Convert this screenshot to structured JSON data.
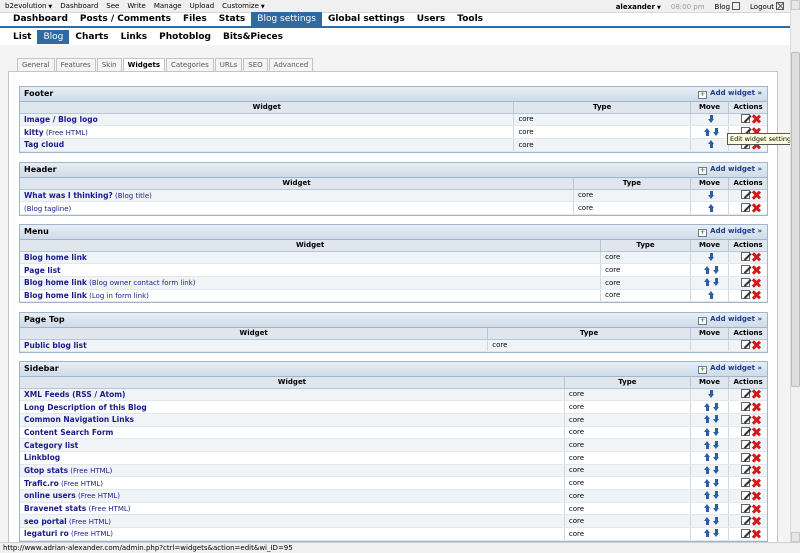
{
  "topbar": {
    "site": "b2evolution",
    "items": [
      "Dashboard",
      "See",
      "Write",
      "Manage",
      "Upload",
      "Customize"
    ],
    "user": "alexander",
    "time": "08:00 pm",
    "blog_label": "Blog",
    "logout_label": "Logout"
  },
  "main_tabs": [
    "Dashboard",
    "Posts / Comments",
    "Files",
    "Stats",
    "Blog settings",
    "Global settings",
    "Users",
    "Tools"
  ],
  "main_tab_active": "Blog settings",
  "sub_tabs": [
    "List",
    "Blog",
    "Charts",
    "Links",
    "Photoblog",
    "Bits&Pieces"
  ],
  "sub_tab_active": "Blog",
  "settings_tabs": [
    "General",
    "Features",
    "Skin",
    "Widgets",
    "Categories",
    "URLs",
    "SEO",
    "Advanced"
  ],
  "settings_tab_active": "Widgets",
  "add_widget_label": "Add widget »",
  "columns": {
    "widget": "Widget",
    "type": "Type",
    "move": "Move",
    "actions": "Actions"
  },
  "containers": [
    {
      "name": "Footer",
      "rows": [
        {
          "name": "Image / Blog logo",
          "sub": "",
          "type": "core",
          "move": [
            "down"
          ]
        },
        {
          "name": "kitty",
          "sub": "(Free HTML)",
          "type": "core",
          "move": [
            "up",
            "down"
          ]
        },
        {
          "name": "Tag cloud",
          "sub": "",
          "type": "core",
          "move": [
            "up"
          ]
        }
      ]
    },
    {
      "name": "Header",
      "rows": [
        {
          "name": "What was I thinking?",
          "sub": "(Blog title)",
          "type": "core",
          "move": [
            "down"
          ]
        },
        {
          "name": "",
          "sub": "(Blog tagline)",
          "type": "core",
          "move": [
            "up"
          ]
        }
      ]
    },
    {
      "name": "Menu",
      "rows": [
        {
          "name": "Blog home link",
          "sub": "",
          "type": "core",
          "move": [
            "down"
          ]
        },
        {
          "name": "Page list",
          "sub": "",
          "type": "core",
          "move": [
            "up",
            "down"
          ]
        },
        {
          "name": "Blog home link",
          "sub": "(Blog owner contact form link)",
          "type": "core",
          "move": [
            "up",
            "down"
          ]
        },
        {
          "name": "Blog home link",
          "sub": "(Log in form link)",
          "type": "core",
          "move": [
            "up"
          ]
        }
      ]
    },
    {
      "name": "Page Top",
      "rows": [
        {
          "name": "Public blog list",
          "sub": "",
          "type": "core",
          "move": []
        }
      ]
    },
    {
      "name": "Sidebar",
      "rows": [
        {
          "name": "XML Feeds (RSS / Atom)",
          "sub": "",
          "type": "core",
          "move": [
            "down"
          ]
        },
        {
          "name": "Long Description of this Blog",
          "sub": "",
          "type": "core",
          "move": [
            "up",
            "down"
          ]
        },
        {
          "name": "Common Navigation Links",
          "sub": "",
          "type": "core",
          "move": [
            "up",
            "down"
          ]
        },
        {
          "name": "Content Search Form",
          "sub": "",
          "type": "core",
          "move": [
            "up",
            "down"
          ]
        },
        {
          "name": "Category list",
          "sub": "",
          "type": "core",
          "move": [
            "up",
            "down"
          ]
        },
        {
          "name": "Linkblog",
          "sub": "",
          "type": "core",
          "move": [
            "up",
            "down"
          ]
        },
        {
          "name": "Gtop stats",
          "sub": "(Free HTML)",
          "type": "core",
          "move": [
            "up",
            "down"
          ]
        },
        {
          "name": "Trafic.ro",
          "sub": "(Free HTML)",
          "type": "core",
          "move": [
            "up",
            "down"
          ]
        },
        {
          "name": "online users",
          "sub": "(Free HTML)",
          "type": "core",
          "move": [
            "up",
            "down"
          ]
        },
        {
          "name": "Bravenet stats",
          "sub": "(Free HTML)",
          "type": "core",
          "move": [
            "up",
            "down"
          ]
        },
        {
          "name": "seo portal",
          "sub": "(Free HTML)",
          "type": "core",
          "move": [
            "up",
            "down"
          ]
        },
        {
          "name": "legaturi ro",
          "sub": "(Free HTML)",
          "type": "core",
          "move": [
            "up",
            "down"
          ]
        }
      ]
    }
  ],
  "tooltip": "Edit widget settings!",
  "status_url": "http://www.adrian-alexander.com/admin.php?ctrl=widgets&action=edit&wi_ID=95"
}
